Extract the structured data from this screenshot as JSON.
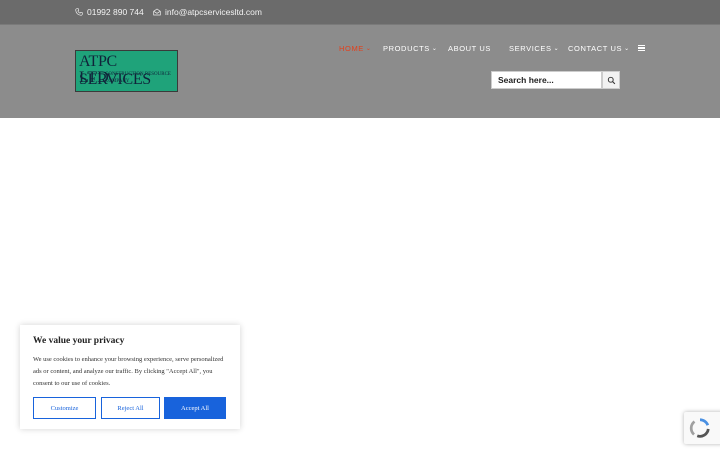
{
  "topbar": {
    "phone": "01992 890 744",
    "email": "info@atpcservicesltd.com",
    "phone_icon": "phone-icon",
    "email_icon": "envelope-icon"
  },
  "logo": {
    "line1": "ATPC SERVICES",
    "line2": "LTD",
    "line3": "CONSTRUCTION RESOURCE",
    "line4": "COMPANY",
    "color": "#1fa37a"
  },
  "nav": {
    "items": [
      {
        "label": "HOME",
        "has_dropdown": true,
        "active": true
      },
      {
        "label": "PRODUCTS",
        "has_dropdown": true,
        "active": false
      },
      {
        "label": "ABOUT US",
        "has_dropdown": false,
        "active": false
      },
      {
        "label": "SERVICES",
        "has_dropdown": true,
        "active": false
      },
      {
        "label": "CONTACT US",
        "has_dropdown": true,
        "active": false
      }
    ],
    "active_color": "#e2401c",
    "menu_icon": "hamburger-icon"
  },
  "search": {
    "placeholder": "Search here...",
    "icon": "search-icon"
  },
  "cookie": {
    "title": "We value your privacy",
    "text": "We use cookies to enhance your browsing experience, serve personalized ads or content, and analyze our traffic. By clicking \"Accept All\", you consent to our use of cookies.",
    "customize_label": "Customize",
    "reject_label": "Reject All",
    "accept_label": "Accept All",
    "accent_color": "#1863dc"
  },
  "recaptcha": {
    "icon": "recaptcha-icon"
  }
}
